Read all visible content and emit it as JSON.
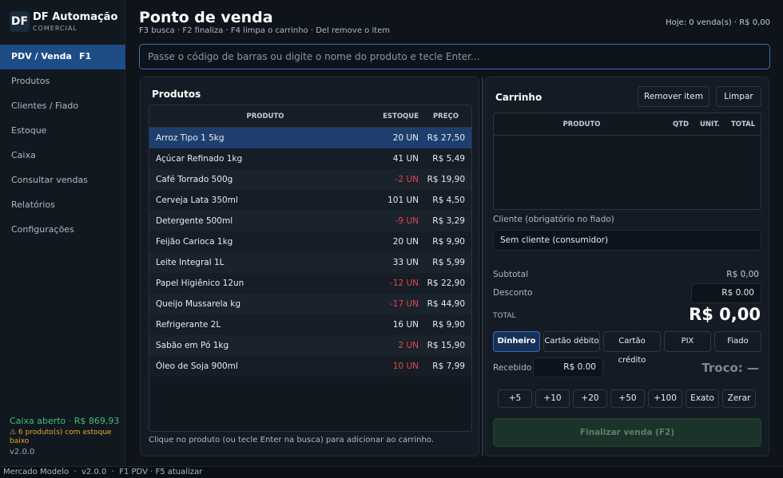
{
  "brand": {
    "logo": "DF",
    "name": "DF Automação",
    "subtitle": "COMERCIAL"
  },
  "sidebar": {
    "items": [
      {
        "label": "PDV / Venda",
        "shortcut": "F1",
        "active": true
      },
      {
        "label": "Produtos"
      },
      {
        "label": "Clientes / Fiado"
      },
      {
        "label": "Estoque"
      },
      {
        "label": "Caixa"
      },
      {
        "label": "Consultar vendas"
      },
      {
        "label": "Relatórios"
      },
      {
        "label": "Configurações"
      }
    ],
    "cash_status": "Caixa aberto · R$ 869,93",
    "stock_warning": "⚠ 6 produto(s) com estoque baixo",
    "version": "v2.0.0"
  },
  "header": {
    "title": "Ponto de venda",
    "shortcuts": "F3 busca · F2 finaliza · F4 limpa o carrinho · Del remove o item",
    "today": "Hoje: 0 venda(s) · R$ 0,00"
  },
  "search": {
    "placeholder": "Passe o código de barras ou digite o nome do produto e tecle Enter..."
  },
  "products": {
    "title": "Produtos",
    "columns": {
      "name": "PRODUTO",
      "stock": "ESTOQUE",
      "price": "PREÇO"
    },
    "rows": [
      {
        "name": "Arroz Tipo 1 5kg",
        "stock": "20 UN",
        "price": "R$ 27,50"
      },
      {
        "name": "Açúcar Refinado 1kg",
        "stock": "41 UN",
        "price": "R$ 5,49"
      },
      {
        "name": "Café Torrado 500g",
        "stock": "-2 UN",
        "price": "R$ 19,90"
      },
      {
        "name": "Cerveja Lata 350ml",
        "stock": "101 UN",
        "price": "R$ 4,50"
      },
      {
        "name": "Detergente 500ml",
        "stock": "-9 UN",
        "price": "R$ 3,29"
      },
      {
        "name": "Feijão Carioca 1kg",
        "stock": "20 UN",
        "price": "R$ 9,90"
      },
      {
        "name": "Leite Integral 1L",
        "stock": "33 UN",
        "price": "R$ 5,99"
      },
      {
        "name": "Papel Higiênico 12un",
        "stock": "-12 UN",
        "price": "R$ 22,90"
      },
      {
        "name": "Queijo Mussarela kg",
        "stock": "-17 UN",
        "price": "R$ 44,90"
      },
      {
        "name": "Refrigerante 2L",
        "stock": "16 UN",
        "price": "R$ 9,90"
      },
      {
        "name": "Sabão em Pó 1kg",
        "stock": "2 UN",
        "price": "R$ 15,90"
      },
      {
        "name": "Óleo de Soja 900ml",
        "stock": "10 UN",
        "price": "R$ 7,99"
      }
    ],
    "hint": "Clique no produto (ou tecle Enter na busca) para adicionar ao carrinho."
  },
  "cart": {
    "title": "Carrinho",
    "remove_label": "Remover item",
    "clear_label": "Limpar",
    "columns": {
      "name": "PRODUTO",
      "qty": "QTD",
      "unit": "UNIT.",
      "total": "TOTAL"
    },
    "client_label": "Cliente (obrigatório no fiado)",
    "client_value": "Sem cliente (consumidor)",
    "subtotal_label": "Subtotal",
    "subtotal_value": "R$ 0,00",
    "discount_label": "Desconto",
    "discount_value": "R$ 0.00",
    "total_label": "TOTAL",
    "total_value": "R$ 0,00",
    "payment_methods": [
      "Dinheiro",
      "Cartão débito",
      "Cartão crédito",
      "PIX",
      "Fiado"
    ],
    "received_label": "Recebido",
    "received_value": "R$ 0.00",
    "change_text": "Troco: —",
    "quick_amounts": [
      "+5",
      "+10",
      "+20",
      "+50",
      "+100",
      "Exato",
      "Zerar"
    ],
    "finalize_label": "Finalizar venda   (F2)"
  },
  "statusbar": {
    "text": "Mercado Modelo  ·  v2.0.0  ·  F1 PDV · F5 atualizar"
  },
  "colors": {
    "accent": "#1e4c86",
    "negative": "#e0484a",
    "positive": "#3cc07b",
    "warning": "#e3a92e"
  }
}
